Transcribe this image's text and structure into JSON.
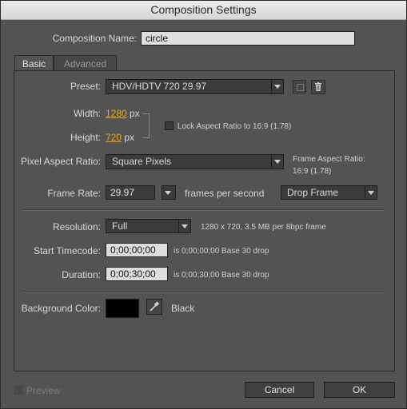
{
  "window": {
    "title": "Composition Settings"
  },
  "comp_name": {
    "label": "Composition Name:",
    "value": "circle"
  },
  "tabs": [
    {
      "label": "Basic",
      "active": true
    },
    {
      "label": "Advanced",
      "active": false
    }
  ],
  "preset": {
    "label": "Preset:",
    "value": "HDV/HDTV 720 29.97"
  },
  "width": {
    "label": "Width:",
    "value": "1280",
    "unit": "px"
  },
  "height": {
    "label": "Height:",
    "value": "720",
    "unit": "px"
  },
  "lock_aspect": {
    "label": "Lock Aspect Ratio to 16:9 (1.78)",
    "checked": false
  },
  "pixel_aspect": {
    "label": "Pixel Aspect Ratio:",
    "value": "Square Pixels"
  },
  "frame_aspect": {
    "label": "Frame Aspect Ratio:",
    "value": "16:9 (1.78)"
  },
  "frame_rate": {
    "label": "Frame Rate:",
    "value": "29.97",
    "unit": "frames per second",
    "mode": "Drop Frame"
  },
  "resolution": {
    "label": "Resolution:",
    "value": "Full",
    "info": "1280 x 720, 3.5 MB per 8bpc frame"
  },
  "start_timecode": {
    "label": "Start Timecode:",
    "value": "0;00;00;00",
    "info": "is 0;00;00;00  Base 30  drop"
  },
  "duration": {
    "label": "Duration:",
    "value": "0;00;30;00",
    "info": "is 0;00;30;00  Base 30  drop"
  },
  "background": {
    "label": "Background Color:",
    "color": "#000000",
    "name": "Black"
  },
  "footer": {
    "preview_label": "Preview",
    "cancel_label": "Cancel",
    "ok_label": "OK"
  },
  "colors": {
    "accent_number": "#e8a917",
    "dialog_bg": "#535353"
  }
}
